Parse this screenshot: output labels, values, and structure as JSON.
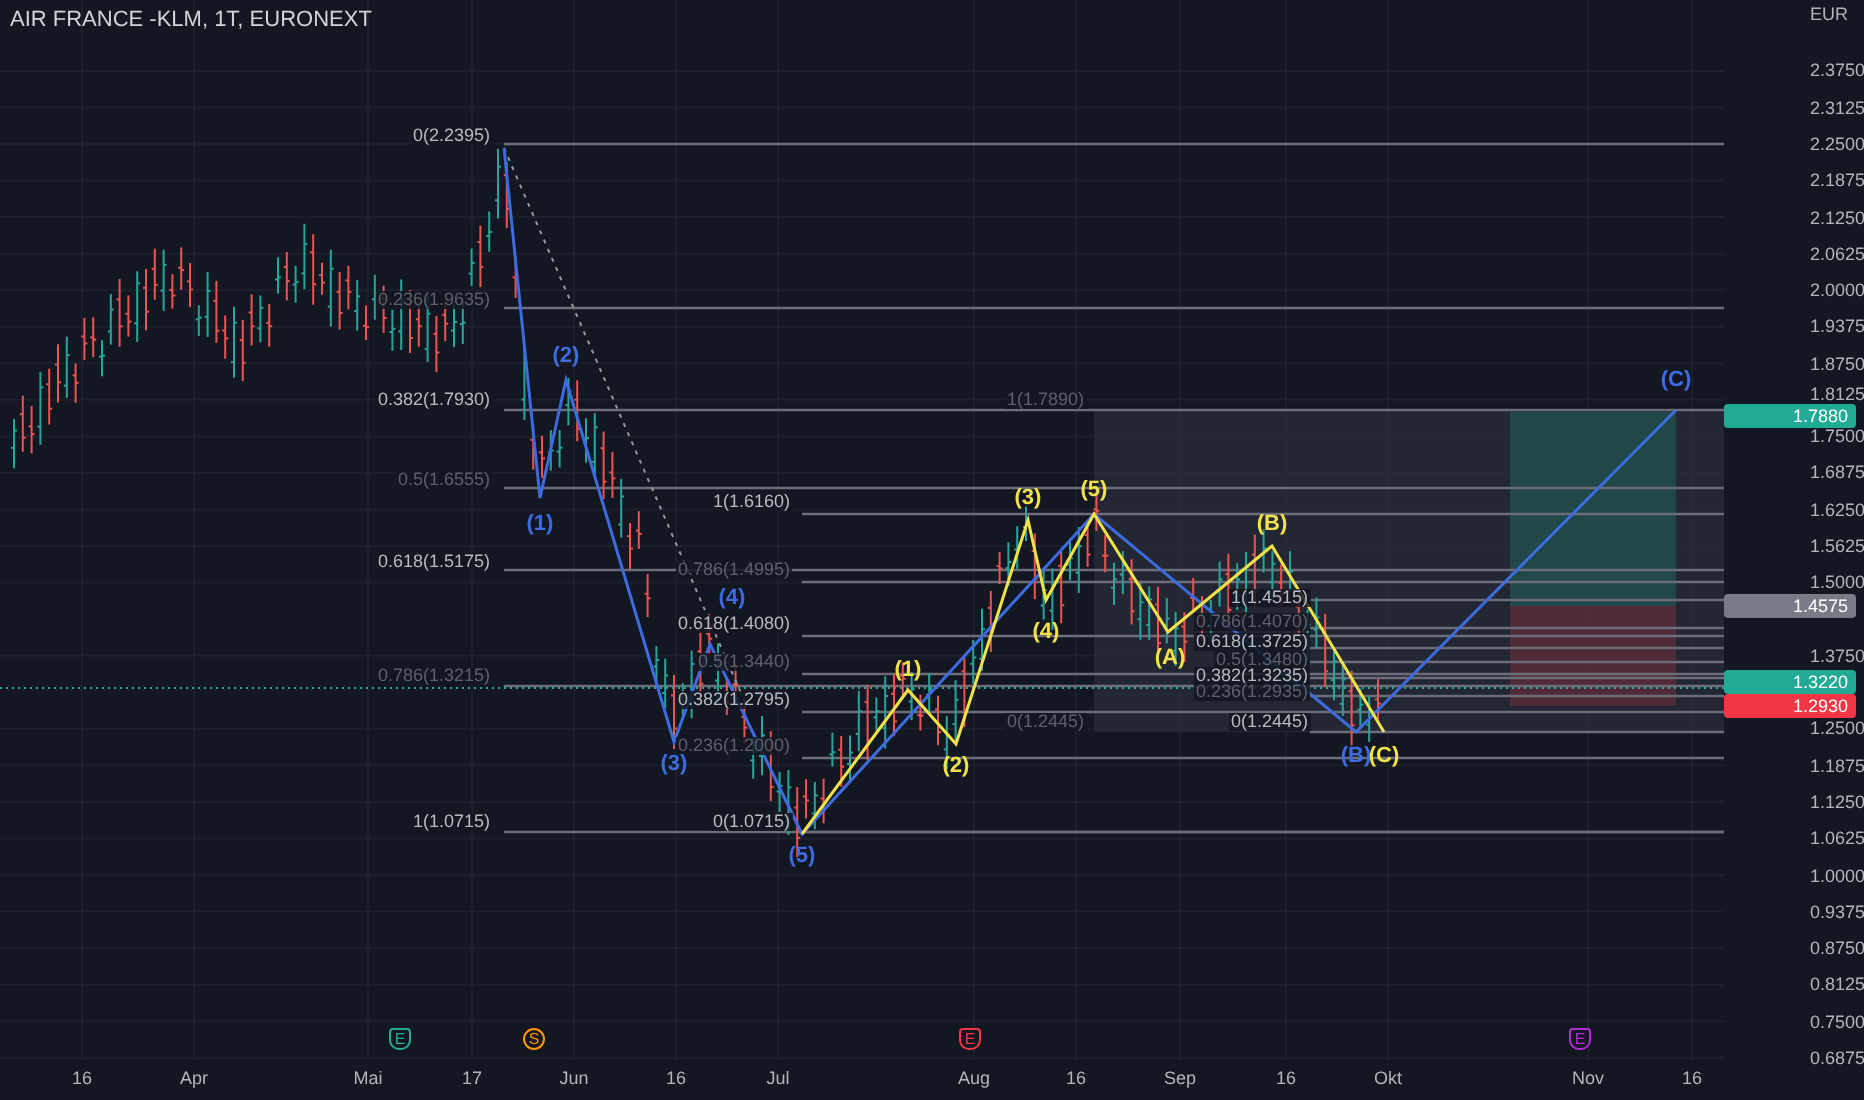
{
  "chart": {
    "title": "AIR FRANCE -KLM, 1T, EURONEXT",
    "currency": "EUR",
    "price_axis": [
      "2.3750",
      "2.3125",
      "2.2500",
      "2.1875",
      "2.1250",
      "2.0625",
      "2.0000",
      "1.9375",
      "1.8750",
      "1.8125",
      "1.7500",
      "1.6875",
      "1.6250",
      "1.5625",
      "1.5000",
      "1.3750",
      "1.2500",
      "1.1875",
      "1.1250",
      "1.0625",
      "1.0000",
      "0.9375",
      "0.8750",
      "0.8125",
      "0.7500",
      "0.6875"
    ],
    "price_tags": [
      {
        "label": "1.7880",
        "color": "#22ab94"
      },
      {
        "label": "1.4575",
        "color": "#787b86"
      },
      {
        "label": "1.3220",
        "color": "#22ab94"
      },
      {
        "label": "1.2930",
        "color": "#f23645"
      }
    ],
    "fib_labels": [
      {
        "text": "0(2.2395)",
        "dim": false
      },
      {
        "text": "0.236(1.9635)",
        "dim": true
      },
      {
        "text": "0.382(1.7930)",
        "dim": false
      },
      {
        "text": "0.5(1.6555)",
        "dim": true
      },
      {
        "text": "0.618(1.5175)",
        "dim": false
      },
      {
        "text": "0.786(1.3215)",
        "dim": true
      },
      {
        "text": "1(1.0715)",
        "dim": false
      },
      {
        "text": "1(1.6160)",
        "dim": false
      },
      {
        "text": "0.786(1.4995)",
        "dim": true
      },
      {
        "text": "0.618(1.4080)",
        "dim": false
      },
      {
        "text": "0.5(1.3440)",
        "dim": true
      },
      {
        "text": "0.382(1.2795)",
        "dim": false
      },
      {
        "text": "0.236(1.2000)",
        "dim": true
      },
      {
        "text": "0(1.0715)",
        "dim": false
      },
      {
        "text": "1(1.7890)",
        "dim": true
      },
      {
        "text": "0(1.2445)",
        "dim": true
      },
      {
        "text": "1(1.4515)",
        "dim": false
      },
      {
        "text": "0.786(1.4070)",
        "dim": true
      },
      {
        "text": "0.618(1.3725)",
        "dim": false
      },
      {
        "text": "0.5(1.3480)",
        "dim": true
      },
      {
        "text": "0.382(1.3235)",
        "dim": false
      },
      {
        "text": "0.236(1.2935)",
        "dim": true
      },
      {
        "text": "0(1.2445)",
        "dim": false
      }
    ],
    "wave_labels": [
      {
        "label": "(2)",
        "color": "#3d6be0"
      },
      {
        "label": "(1)",
        "color": "#3d6be0"
      },
      {
        "label": "(3)",
        "color": "#3d6be0"
      },
      {
        "label": "(4)",
        "color": "#3d6be0"
      },
      {
        "label": "(5)",
        "color": "#3d6be0"
      },
      {
        "label": "(1)",
        "color": "#f2e24a"
      },
      {
        "label": "(2)",
        "color": "#f2e24a"
      },
      {
        "label": "(3)",
        "color": "#f2e24a"
      },
      {
        "label": "(4)",
        "color": "#f2e24a"
      },
      {
        "label": "(5)",
        "color": "#f2e24a"
      },
      {
        "label": "(A)",
        "color": "#f2e24a"
      },
      {
        "label": "(B)",
        "color": "#f2e24a"
      },
      {
        "label": "(B)",
        "color": "#3d6be0"
      },
      {
        "label": "(C)",
        "color": "#f2e24a"
      },
      {
        "label": "(C)",
        "color": "#3d6be0"
      }
    ],
    "events": [
      {
        "letter": "E",
        "kind": "tag",
        "color": "#22ab94"
      },
      {
        "letter": "S",
        "kind": "round",
        "color": "#ff9800"
      },
      {
        "letter": "E",
        "kind": "tag",
        "color": "#f23645"
      },
      {
        "letter": "E",
        "kind": "tag",
        "color": "#b42ad8"
      }
    ],
    "time_axis": [
      "16",
      "Apr",
      "Mai",
      "17",
      "Jun",
      "16",
      "Jul",
      "Aug",
      "16",
      "Sep",
      "16",
      "Okt",
      "Nov",
      "16"
    ]
  }
}
